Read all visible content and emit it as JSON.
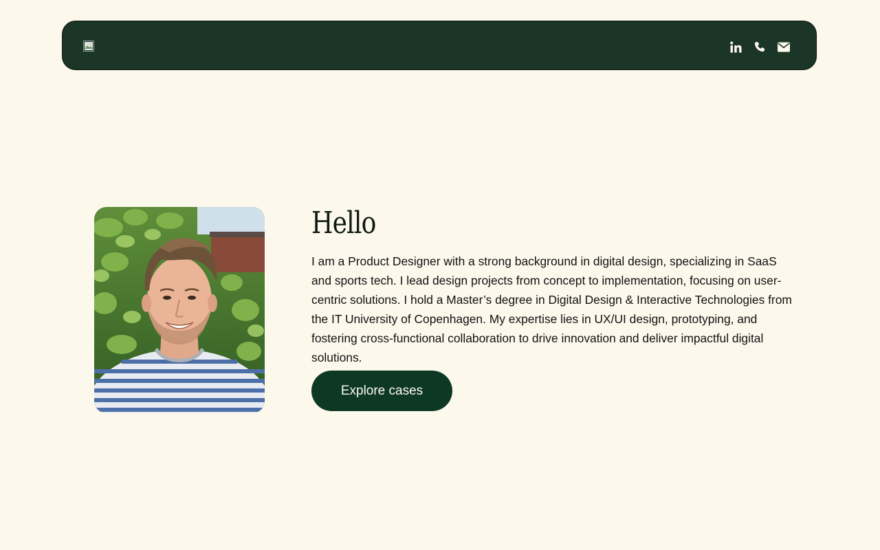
{
  "header": {
    "logo_alt": "",
    "social": [
      {
        "icon": "linkedin-icon",
        "label": "LinkedIn"
      },
      {
        "icon": "phone-icon",
        "label": "Phone"
      },
      {
        "icon": "email-icon",
        "label": "Email"
      }
    ]
  },
  "hero": {
    "portrait_alt": "",
    "title": "Hello",
    "bio": "I am a Product Designer with a strong background in digital design, specializing in SaaS and sports tech. I lead design projects from concept to implementation, focusing on user-centric solutions. I hold a Master’s degree in Digital Design & Interactive Technologies from the IT University of Copenhagen. My expertise lies in UX/UI design, prototyping, and fostering cross-functional collaboration to drive innovation and deliver impactful digital solutions.",
    "cta_label": "Explore cases"
  },
  "colors": {
    "page_background": "#fdf8ec",
    "navbar_background": "#1b3526",
    "cta_background": "#0d3823",
    "icon_color": "#fdf8ec",
    "text_color": "#111111"
  }
}
